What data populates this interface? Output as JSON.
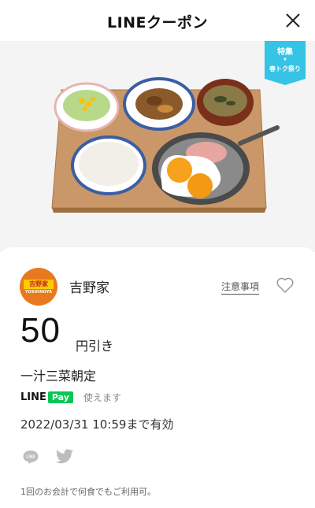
{
  "header": {
    "title": "LINEクーポン",
    "close_icon": "close-icon"
  },
  "badge": {
    "line1": "特集",
    "star": "★",
    "line2": "春トク祭り",
    "color": "#35c3e6"
  },
  "brand": {
    "name": "吉野家",
    "logo_text": "吉野家",
    "logo_sub": "YOSHINOYA",
    "logo_color": "#e8791f"
  },
  "notes_label": "注意事項",
  "coupon": {
    "amount": "50",
    "unit": "円引き",
    "item": "一汁三菜朝定"
  },
  "pay": {
    "line": "LINE",
    "pay": "Pay",
    "usable": "使えます",
    "color": "#06c755"
  },
  "validity": "2022/03/31 10:59まで有効",
  "share": {
    "line_icon": "line-icon",
    "twitter_icon": "twitter-icon"
  },
  "footnote": "1回のお会計で何食でもご利用可。"
}
